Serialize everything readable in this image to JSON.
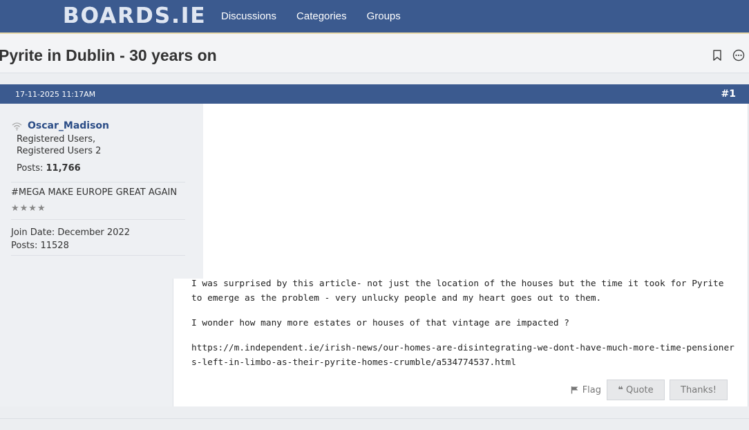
{
  "site": {
    "logo_text": "BOARDS.IE"
  },
  "nav": {
    "items": [
      "Discussions",
      "Categories",
      "Groups"
    ]
  },
  "thread": {
    "title": "Pyrite in Dublin - 30 years on"
  },
  "post": {
    "date": "17-11-2025 11:17AM",
    "number": "#1",
    "user": {
      "name": "Oscar_Madison",
      "groups_line1": "Registered Users,",
      "groups_line2": "Registered Users 2",
      "posts_label": "Posts:",
      "posts_count": "11,766",
      "user_title": "#MEGA MAKE EUROPE GREAT AGAIN",
      "stars": "★★★★",
      "join_date": "Join Date: December 2022",
      "posts_legacy": "Posts: 11528"
    },
    "message": {
      "p1": "I was surprised by this article- not just the location of the houses but the time it took for Pyrite to emerge as the problem - very unlucky people and my heart goes out to them.",
      "p2": "I wonder how many more estates or houses of that vintage are impacted ?",
      "link": "https://m.independent.ie/irish-news/our-homes-are-disintegrating-we-dont-have-much-more-time-pensioners-left-in-limbo-as-their-pyrite-homes-crumble/a534774537.html"
    },
    "actions": {
      "flag": "Flag",
      "quote": "Quote",
      "thanks": "Thanks!"
    }
  },
  "colors": {
    "header_blue": "#3b5a8f",
    "username_blue": "#2a4c86"
  }
}
